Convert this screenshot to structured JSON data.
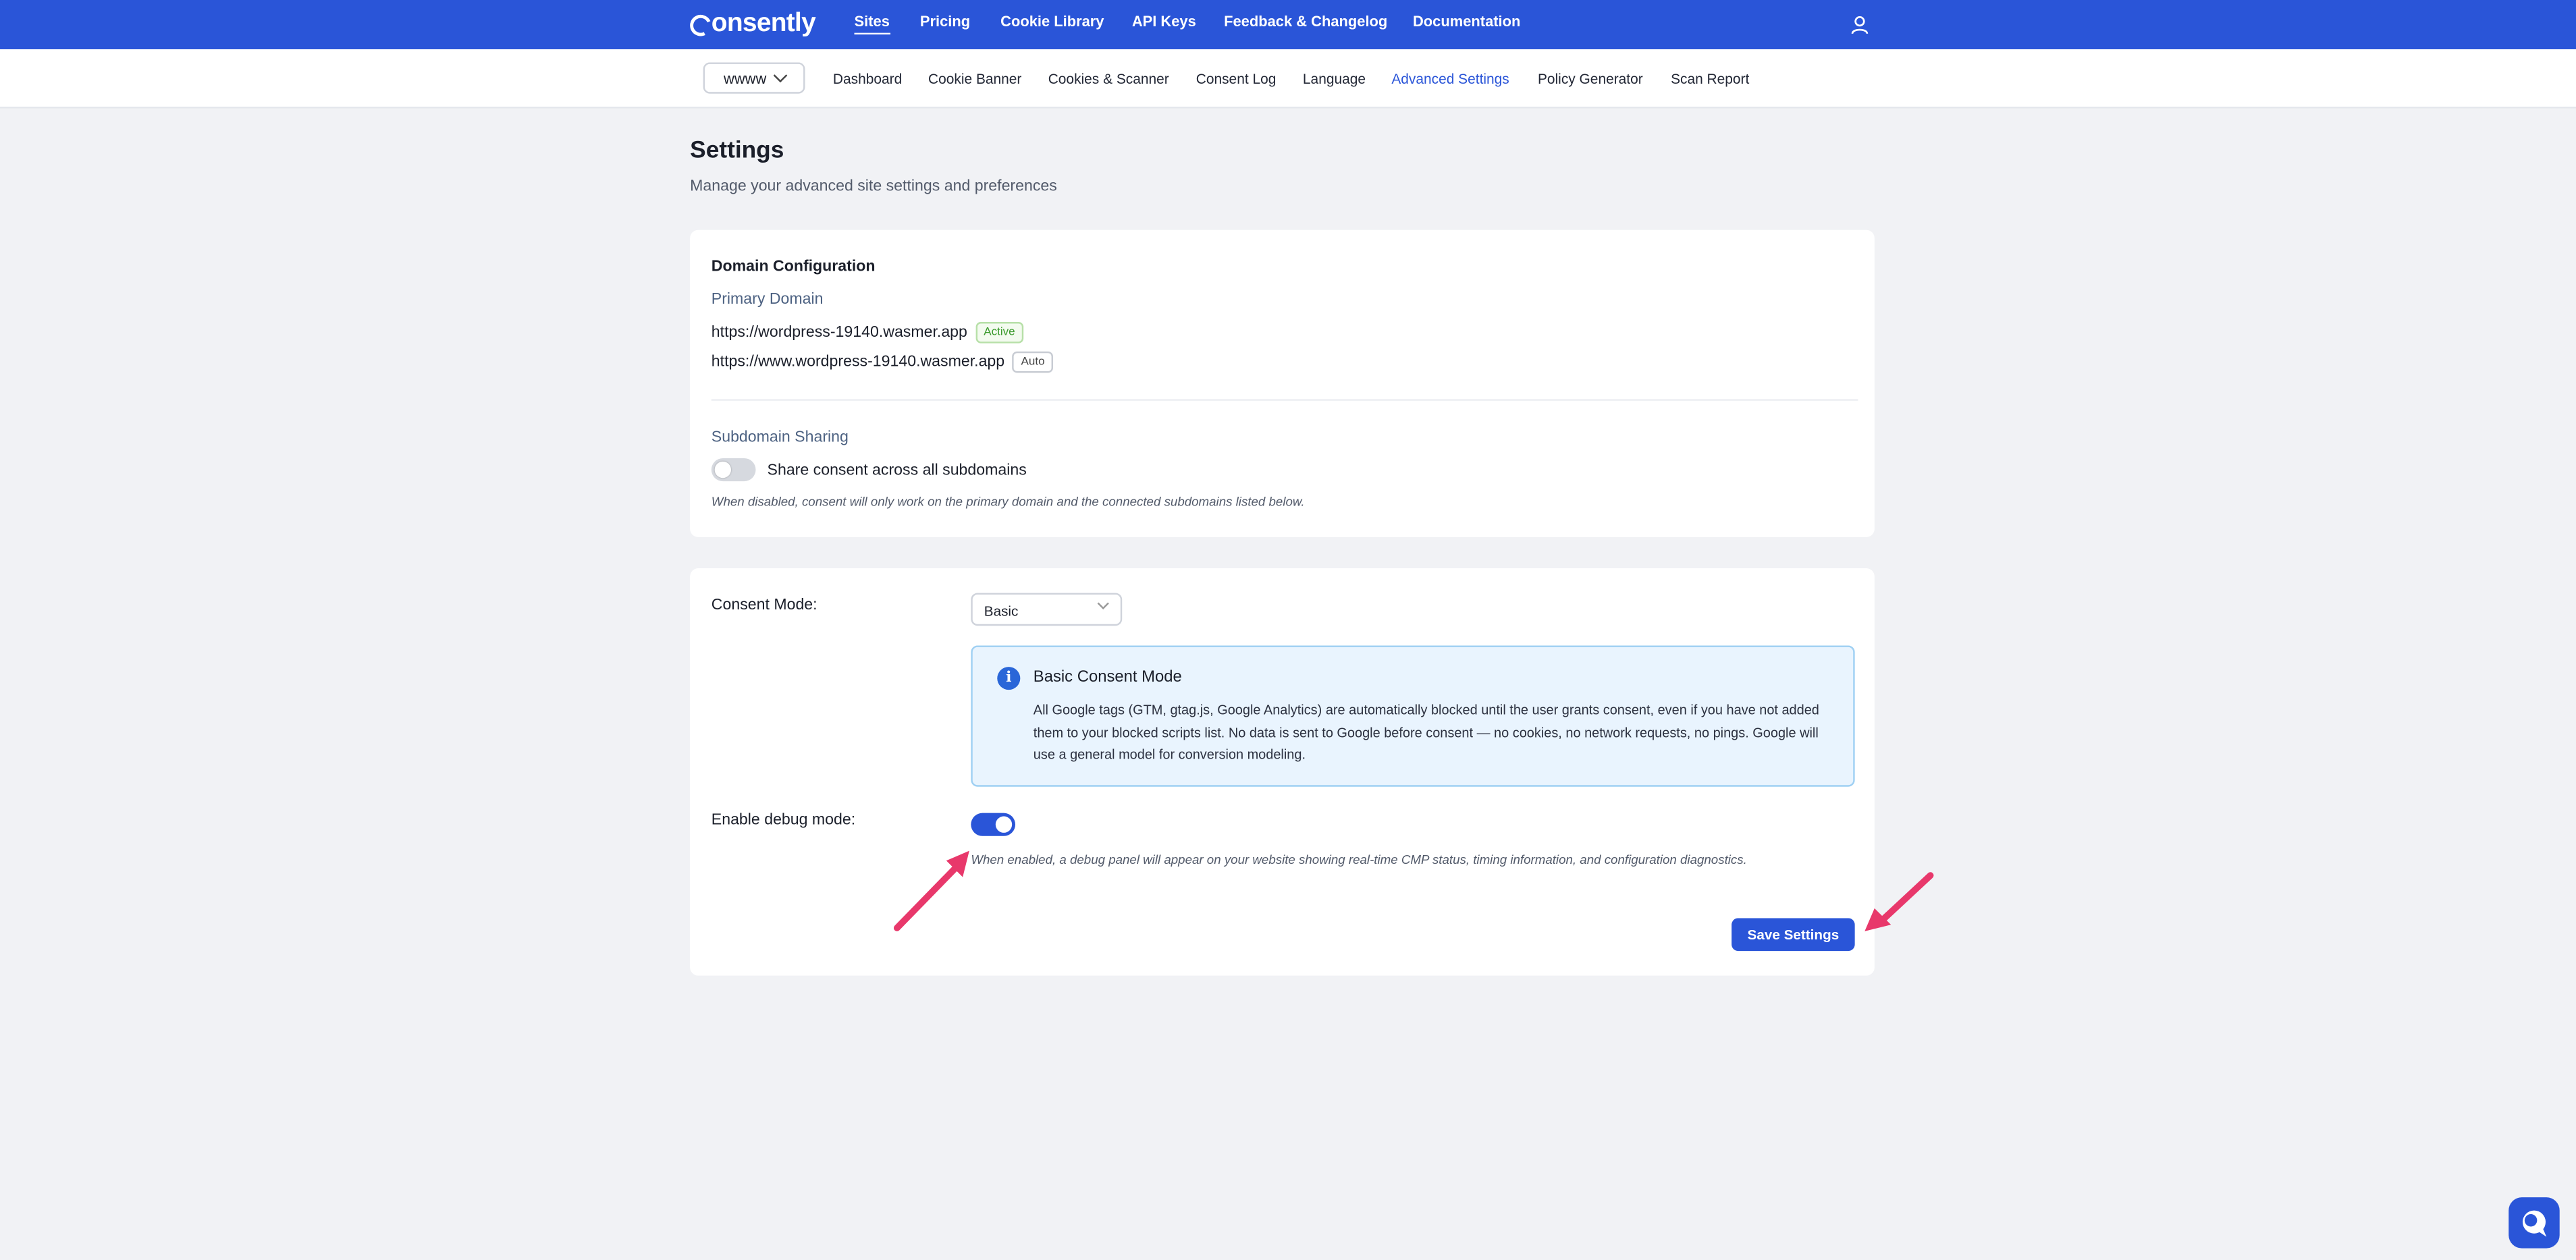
{
  "brand": {
    "name": "onsently"
  },
  "topnav": {
    "links": [
      "Sites",
      "Pricing",
      "Cookie Library",
      "API Keys",
      "Feedback & Changelog",
      "Documentation"
    ],
    "active": "Sites",
    "user_icon": "user-icon"
  },
  "subnav": {
    "site_selector": "wwww",
    "links": [
      "Dashboard",
      "Cookie Banner",
      "Cookies & Scanner",
      "Consent Log",
      "Language",
      "Advanced Settings",
      "Policy Generator",
      "Scan Report"
    ],
    "active": "Advanced Settings"
  },
  "page": {
    "title": "Settings",
    "subtitle": "Manage your advanced site settings and preferences"
  },
  "domain_config": {
    "heading": "Domain Configuration",
    "primary_label": "Primary Domain",
    "domains": [
      {
        "url": "https://wordpress-19140.wasmer.app",
        "badge": "Active"
      },
      {
        "url": "https://www.wordpress-19140.wasmer.app",
        "badge": "Auto"
      }
    ],
    "subdomain_label": "Subdomain Sharing",
    "subdomain_toggle_label": "Share consent across all subdomains",
    "subdomain_toggle_on": false,
    "subdomain_helper": "When disabled, consent will only work on the primary domain and the connected subdomains listed below."
  },
  "consent": {
    "mode_label": "Consent Mode:",
    "mode_value": "Basic",
    "info_title": "Basic Consent Mode",
    "info_body": "All Google tags (GTM, gtag.js, Google Analytics) are automatically blocked until the user grants consent, even if you have not added them to your blocked scripts list. No data is sent to Google before consent — no cookies, no network requests, no pings. Google will use a general model for conversion modeling.",
    "debug_label": "Enable debug mode:",
    "debug_on": true,
    "debug_helper": "When enabled, a debug panel will appear on your website showing real-time CMP status, timing information, and configuration diagnostics.",
    "save_label": "Save Settings"
  },
  "colors": {
    "accent": "#2a55d8",
    "annotation_arrow": "#e8386b",
    "success": "#3a9a2c"
  }
}
